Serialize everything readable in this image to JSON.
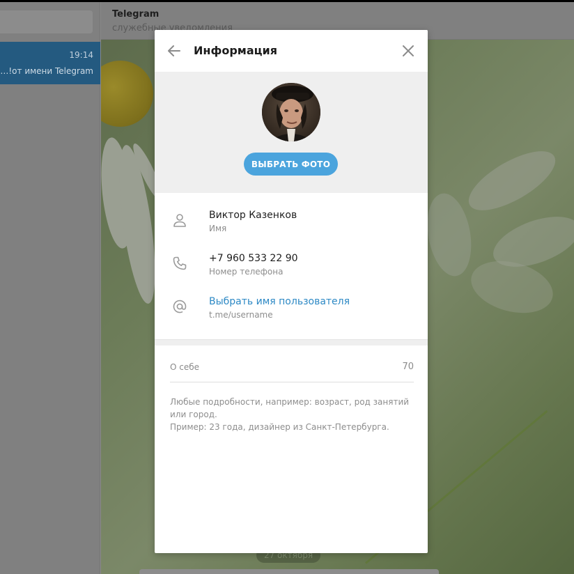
{
  "background": {
    "chat_list": {
      "item": {
        "time": "19:14",
        "preview": "от имени Telegram! ..."
      }
    },
    "chat_header": {
      "title": "Telegram",
      "status": "служебные уведомления"
    },
    "date_pill": "27 октября"
  },
  "modal": {
    "title": "Информация",
    "choose_photo_label": "ВЫБРАТЬ ФОТО",
    "rows": [
      {
        "value": "Виктор Казенков",
        "sub": "Имя",
        "icon": "user-icon"
      },
      {
        "value": "+7 960 533 22 90",
        "sub": "Номер телефона",
        "icon": "phone-icon"
      },
      {
        "value": "Выбрать имя пользователя",
        "sub": "t.me/username",
        "icon": "at-icon"
      }
    ],
    "bio": {
      "label": "О себе",
      "counter": "70",
      "hint_line1": "Любые подробности, например: возраст, род занятий",
      "hint_line2": "или город.",
      "hint_line3": "Пример: 23 года, дизайнер из Санкт-Петербурга."
    }
  },
  "colors": {
    "accent": "#4ba4dd",
    "link": "#2d89c5",
    "selected_chat": "#245a80"
  }
}
